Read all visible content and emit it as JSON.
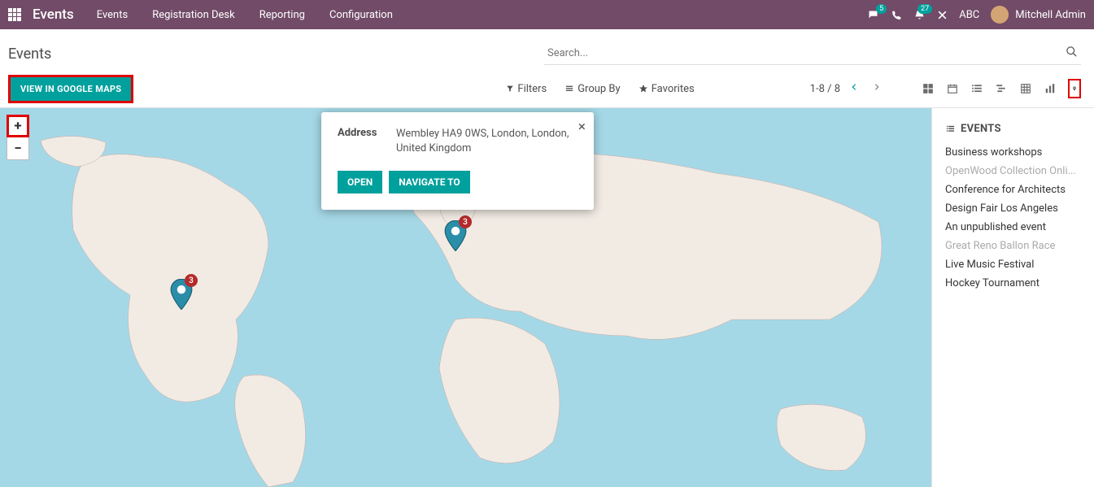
{
  "navbar": {
    "brand": "Events",
    "links": [
      "Events",
      "Registration Desk",
      "Reporting",
      "Configuration"
    ],
    "chat_count": "5",
    "activity_count": "27",
    "company": "ABC",
    "user_name": "Mitchell Admin"
  },
  "control_panel": {
    "title": "Events",
    "search_placeholder": "Search...",
    "gmaps_btn": "VIEW IN GOOGLE MAPS",
    "filters_label": "Filters",
    "groupby_label": "Group By",
    "favorites_label": "Favorites",
    "pager": "1-8 / 8"
  },
  "map": {
    "pins": [
      {
        "id": "us",
        "count": "3"
      },
      {
        "id": "uk",
        "count": "3"
      }
    ],
    "popup": {
      "address_label": "Address",
      "address_value": "Wembley HA9 0WS, London, London, United Kingdom",
      "open_label": "OPEN",
      "navigate_label": "NAVIGATE TO"
    }
  },
  "sidebar": {
    "title": "EVENTS",
    "items": [
      {
        "label": "Business workshops",
        "muted": false
      },
      {
        "label": "OpenWood Collection Onli...",
        "muted": true
      },
      {
        "label": "Conference for Architects",
        "muted": false
      },
      {
        "label": "Design Fair Los Angeles",
        "muted": false
      },
      {
        "label": "An unpublished event",
        "muted": false
      },
      {
        "label": "Great Reno Ballon Race",
        "muted": true
      },
      {
        "label": "Live Music Festival",
        "muted": false
      },
      {
        "label": "Hockey Tournament",
        "muted": false
      }
    ]
  }
}
